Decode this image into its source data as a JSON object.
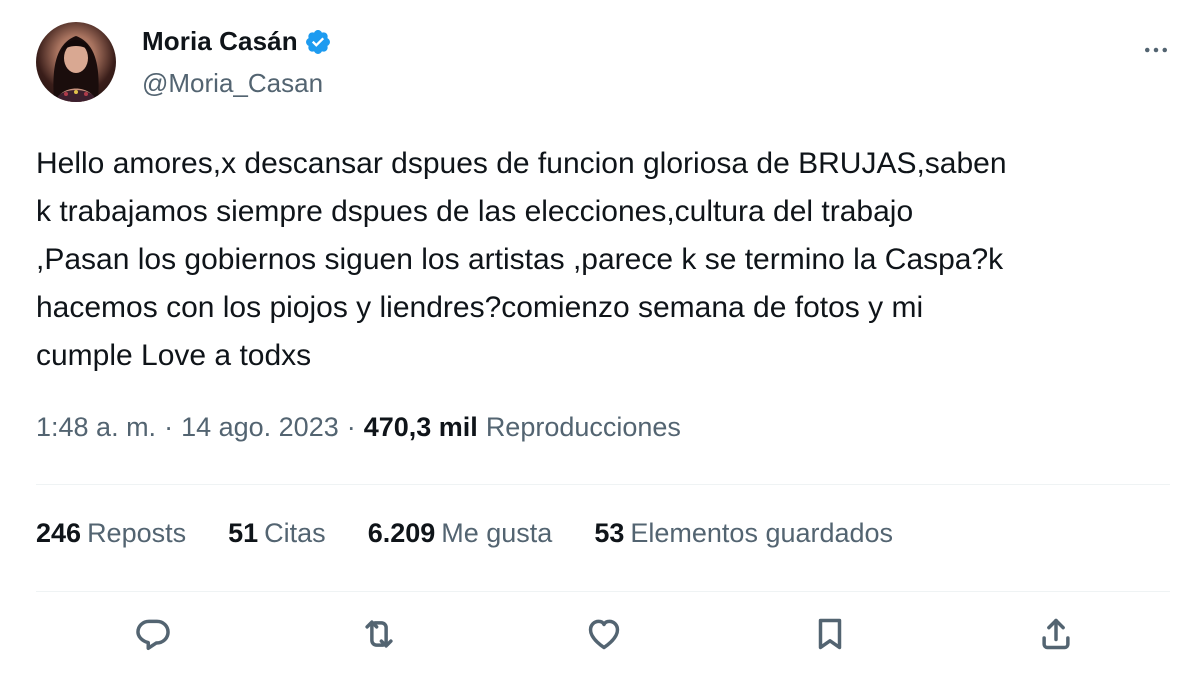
{
  "author": {
    "display_name": "Moria Casán",
    "handle": "@Moria_Casan",
    "verified": true,
    "avatar_icon": "profile-photo"
  },
  "tweet": {
    "text": "Hello amores,x descansar dspues de funcion gloriosa de BRUJAS,saben\nk trabajamos siempre dspues de las elecciones,cultura del trabajo\n,Pasan los gobiernos siguen los artistas ,parece k se termino la Caspa?k\nhacemos con los piojos y liendres?comienzo semana de fotos y mi\ncumple Love a todxs",
    "time": "1:48 a. m.",
    "separator": "·",
    "date": "14 ago. 2023",
    "views_count": "470,3 mil",
    "views_label": "Reproducciones"
  },
  "stats": [
    {
      "count": "246",
      "label": "Reposts"
    },
    {
      "count": "51",
      "label": "Citas"
    },
    {
      "count": "6.209",
      "label": "Me gusta"
    },
    {
      "count": "53",
      "label": "Elementos guardados"
    }
  ],
  "actions": [
    "reply-icon",
    "repost-icon",
    "like-icon",
    "bookmark-icon",
    "share-icon"
  ],
  "colors": {
    "text": "#0f1419",
    "secondary": "#536471",
    "verified": "#1d9bf0",
    "divider": "#eff3f4"
  }
}
